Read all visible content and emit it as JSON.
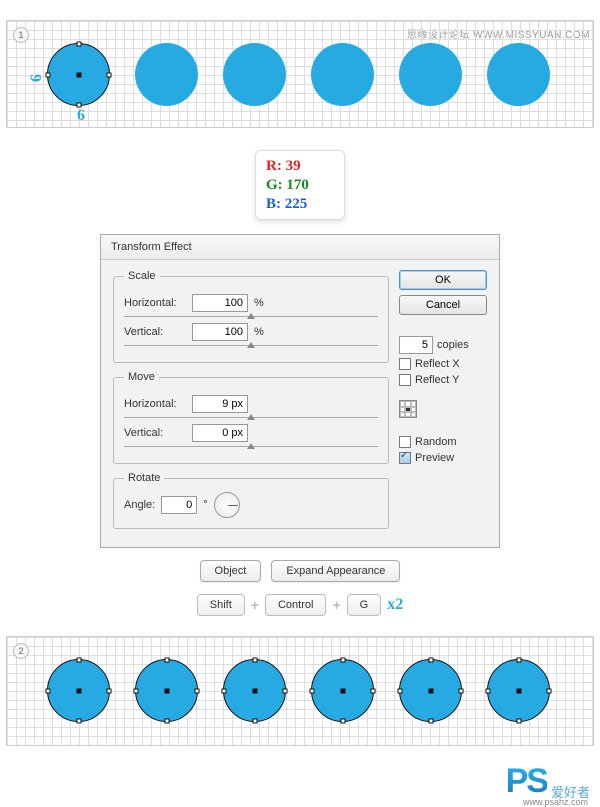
{
  "header": {
    "site_cn": "思缘设计论坛",
    "site_url": "WWW.MISSYUAN.COM"
  },
  "steps": {
    "s1": "1",
    "s2": "2"
  },
  "dims": {
    "w": "6",
    "h": "6"
  },
  "rgb": {
    "r": "R: 39",
    "g": "G: 170",
    "b": "B: 225"
  },
  "dialog": {
    "title": "Transform Effect",
    "scale": {
      "legend": "Scale",
      "h_label": "Horizontal:",
      "h_val": "100",
      "h_unit": "%",
      "v_label": "Vertical:",
      "v_val": "100",
      "v_unit": "%"
    },
    "move": {
      "legend": "Move",
      "h_label": "Horizontal:",
      "h_val": "9 px",
      "v_label": "Vertical:",
      "v_val": "0 px"
    },
    "rotate": {
      "legend": "Rotate",
      "angle_label": "Angle:",
      "angle_val": "0",
      "angle_unit": "°"
    },
    "ok": "OK",
    "cancel": "Cancel",
    "copies_val": "5",
    "copies_label": "copies",
    "reflect_x": "Reflect X",
    "reflect_y": "Reflect Y",
    "random": "Random",
    "preview": "Preview"
  },
  "btns": {
    "object": "Object",
    "expand": "Expand Appearance"
  },
  "keys": {
    "shift": "Shift",
    "control": "Control",
    "g": "G",
    "x2": "x2"
  },
  "footer": {
    "logo": "PS",
    "txt": "爱好者",
    "url": "www.psahz.com"
  }
}
